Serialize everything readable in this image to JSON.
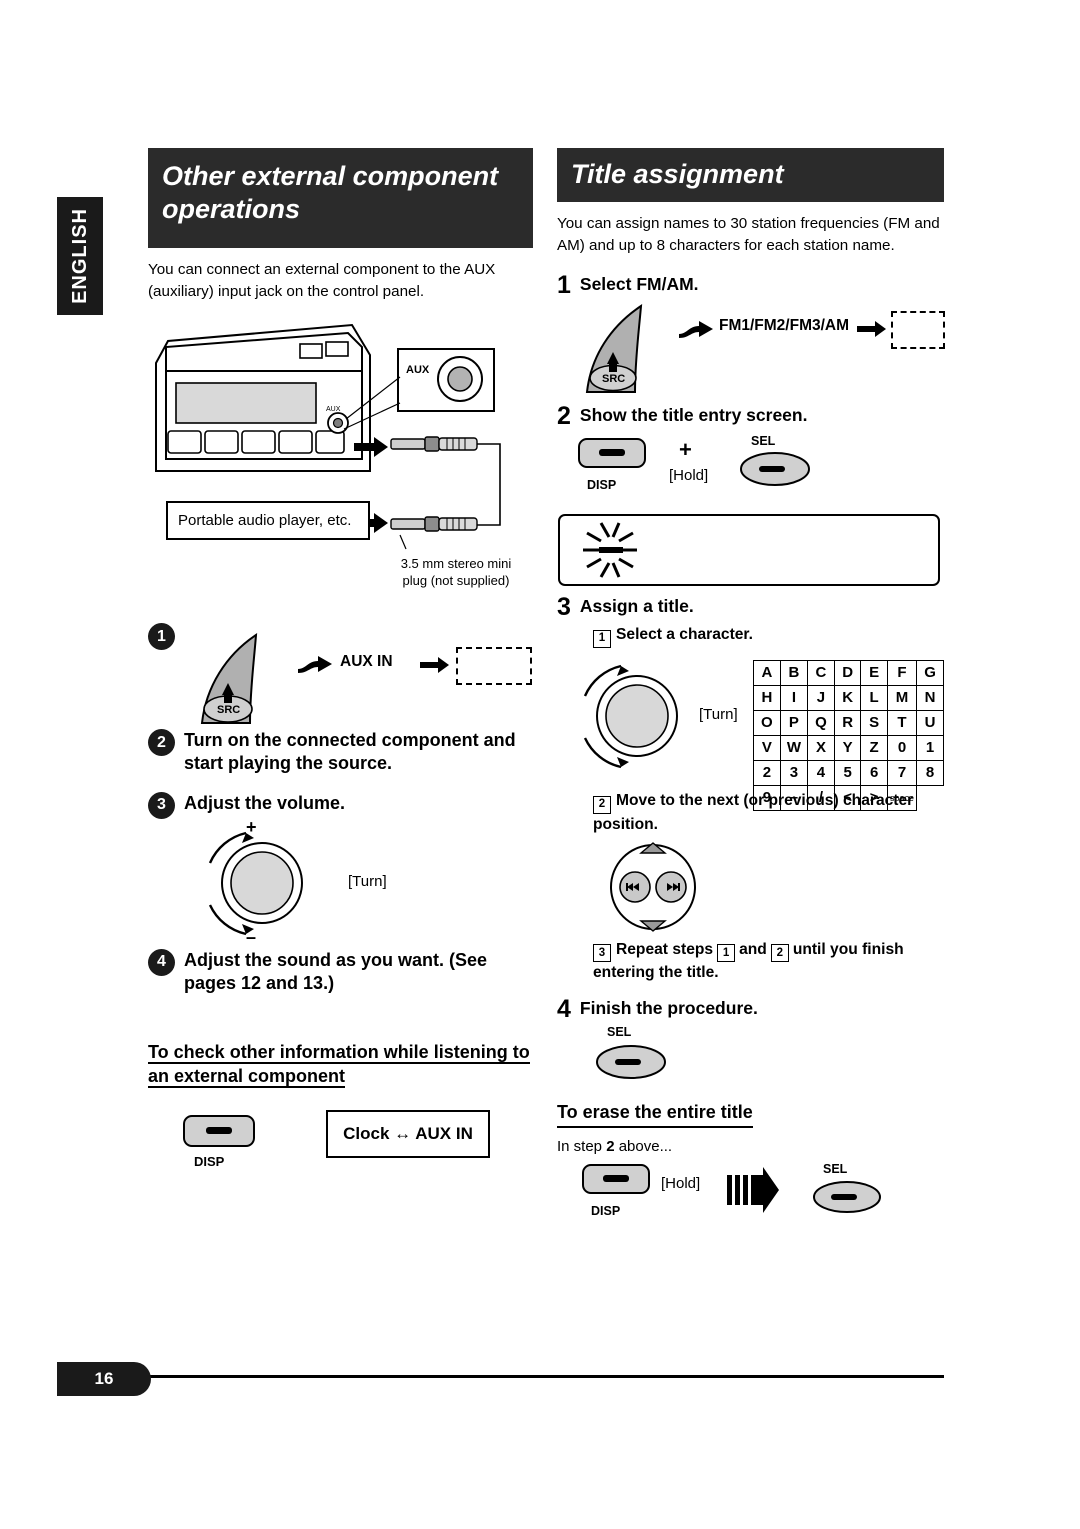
{
  "language_tab": "ENGLISH",
  "page_number": "16",
  "left": {
    "banner_line1": "Other external component",
    "banner_line2": "operations",
    "intro": "You can connect an external component to the AUX (auxiliary) input jack on the control panel.",
    "diagram": {
      "aux_label": "AUX",
      "portable_label": "Portable audio player, etc.",
      "plug_note_line1": "3.5 mm stereo mini",
      "plug_note_line2": "plug (not supplied)"
    },
    "steps": [
      {
        "num": "1",
        "text": "",
        "button": "SRC",
        "display": "AUX IN"
      },
      {
        "num": "2",
        "text": "Turn on the connected component and start playing the source."
      },
      {
        "num": "3",
        "text": "Adjust the volume.",
        "knob": "[Turn]",
        "plus": "+",
        "minus": "–"
      },
      {
        "num": "4",
        "text": "Adjust the sound as you want. (See pages 12 and 13.)"
      }
    ],
    "subheading": "To check other information while listening to an external component",
    "disp_button": "DISP",
    "clock_aux": "Clock ↔ AUX IN"
  },
  "right": {
    "banner": "Title assignment",
    "intro": "You can assign names to 30 station frequencies (FM and AM) and up to 8 characters for each station name.",
    "step1": {
      "num": "1",
      "title": "Select FM/AM.",
      "button": "SRC",
      "display": "FM1/FM2/FM3/AM"
    },
    "step2": {
      "num": "2",
      "title": "Show the title entry screen.",
      "disp_button": "DISP",
      "plus": "+",
      "hold": "[Hold]",
      "sel_button": "SEL"
    },
    "step3": {
      "num": "3",
      "title": "Assign a title.",
      "sub1_num": "1",
      "sub1": "Select a character.",
      "knob": "[Turn]",
      "char_rows": [
        [
          "A",
          "B",
          "C",
          "D",
          "E",
          "F",
          "G"
        ],
        [
          "H",
          "I",
          "J",
          "K",
          "L",
          "M",
          "N"
        ],
        [
          "O",
          "P",
          "Q",
          "R",
          "S",
          "T",
          "U"
        ],
        [
          "V",
          "W",
          "X",
          "Y",
          "Z",
          "0",
          "1"
        ],
        [
          "2",
          "3",
          "4",
          "5",
          "6",
          "7",
          "8"
        ],
        [
          "9",
          "–",
          "/",
          "<",
          ">",
          "space",
          ""
        ]
      ],
      "sub2_num": "2",
      "sub2": "Move to the next (or previous) character position.",
      "sub3_num": "3",
      "sub3_pre": "Repeat steps",
      "sub3_a": "1",
      "sub3_mid": "and",
      "sub3_b": "2",
      "sub3_post": "until you finish entering the title."
    },
    "step4": {
      "num": "4",
      "title": "Finish the procedure.",
      "sel_button": "SEL"
    },
    "erase": {
      "heading": "To erase the entire title",
      "note_pre": "In step",
      "note_num": "2",
      "note_post": "above...",
      "disp_button": "DISP",
      "hold": "[Hold]",
      "sel_button": "SEL"
    }
  }
}
